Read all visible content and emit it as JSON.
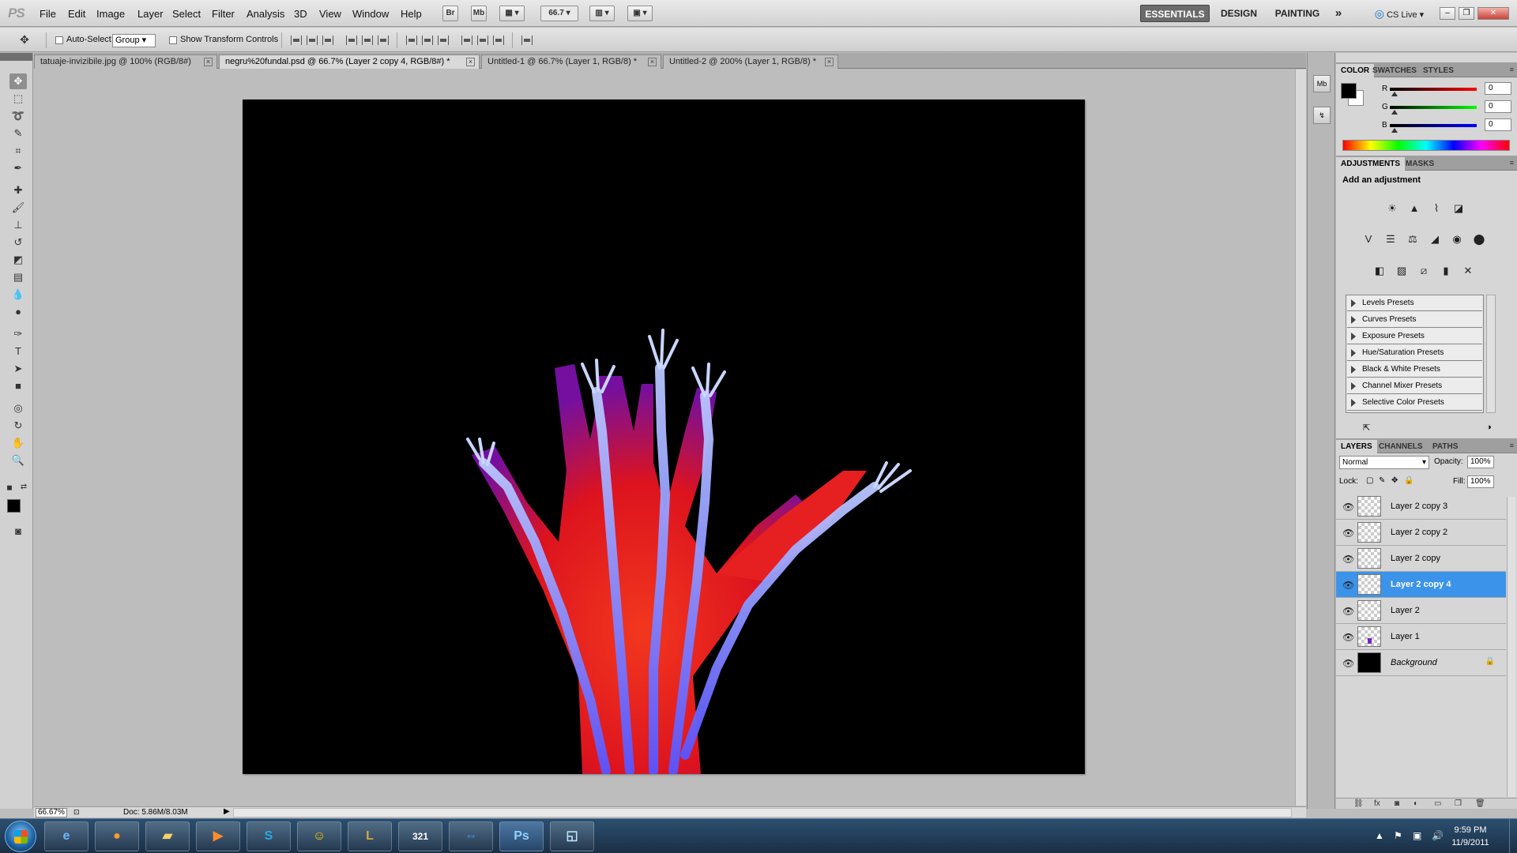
{
  "app": {
    "logo": "PS"
  },
  "menu": [
    "File",
    "Edit",
    "Image",
    "Layer",
    "Select",
    "Filter",
    "Analysis",
    "3D",
    "View",
    "Window",
    "Help"
  ],
  "menubar": {
    "bridge_btn": "Br",
    "minibridge_btn": "Mb",
    "zoom_value": "66.7",
    "workspaces": {
      "essentials": "ESSENTIALS",
      "design": "DESIGN",
      "painting": "PAINTING",
      "more": "»"
    },
    "cslive": "CS Live"
  },
  "options": {
    "auto_select_label": "Auto-Select:",
    "auto_select_value": "Group",
    "show_transform_label": "Show Transform Controls"
  },
  "tabs": [
    {
      "label": "tatuaje-invizibile.jpg @ 100% (RGB/8#)",
      "active": false
    },
    {
      "label": "negru%20fundal.psd @ 66.7% (Layer 2 copy 4, RGB/8#) *",
      "active": true
    },
    {
      "label": "Untitled-1 @ 66.7% (Layer 1, RGB/8) *",
      "active": false
    },
    {
      "label": "Untitled-2 @ 200% (Layer 1, RGB/8) *",
      "active": false
    }
  ],
  "status": {
    "zoom": "66.67%",
    "doc_size": "Doc: 5.86M/8.03M"
  },
  "color_panel": {
    "tabs": [
      "COLOR",
      "SWATCHES",
      "STYLES"
    ],
    "channels": [
      {
        "label": "R",
        "value": "0"
      },
      {
        "label": "G",
        "value": "0"
      },
      {
        "label": "B",
        "value": "0"
      }
    ],
    "foreground": "#000000",
    "background": "#ffffff"
  },
  "adjustments": {
    "tabs": [
      "ADJUSTMENTS",
      "MASKS"
    ],
    "title": "Add an adjustment",
    "presets": [
      "Levels Presets",
      "Curves Presets",
      "Exposure Presets",
      "Hue/Saturation Presets",
      "Black & White Presets",
      "Channel Mixer Presets",
      "Selective Color Presets"
    ]
  },
  "layers_panel": {
    "tabs": [
      "LAYERS",
      "CHANNELS",
      "PATHS"
    ],
    "blend_mode": "Normal",
    "opacity_label": "Opacity:",
    "opacity": "100%",
    "lock_label": "Lock:",
    "fill_label": "Fill:",
    "fill": "100%",
    "layers": [
      {
        "name": "Layer 2 copy 3",
        "selected": false
      },
      {
        "name": "Layer 2 copy 2",
        "selected": false
      },
      {
        "name": "Layer 2 copy",
        "selected": false
      },
      {
        "name": "Layer 2 copy 4",
        "selected": true
      },
      {
        "name": "Layer 2",
        "selected": false
      },
      {
        "name": "Layer 1",
        "selected": false
      },
      {
        "name": "Background",
        "selected": false,
        "locked": true
      }
    ]
  },
  "taskbar": {
    "apps": [
      "Internet Explorer",
      "Firefox",
      "Windows Explorer",
      "Media Player",
      "Skype",
      "Yahoo Messenger",
      "League of Legends",
      "Media Player Classic",
      "TeamViewer",
      "Photoshop",
      "Windows Journal"
    ],
    "time": "9:59 PM",
    "date": "11/9/2011"
  },
  "colors": {
    "selection": "#3b93ea",
    "canvas_bg": "#000000",
    "workspace_active": "#6b6b6b"
  }
}
